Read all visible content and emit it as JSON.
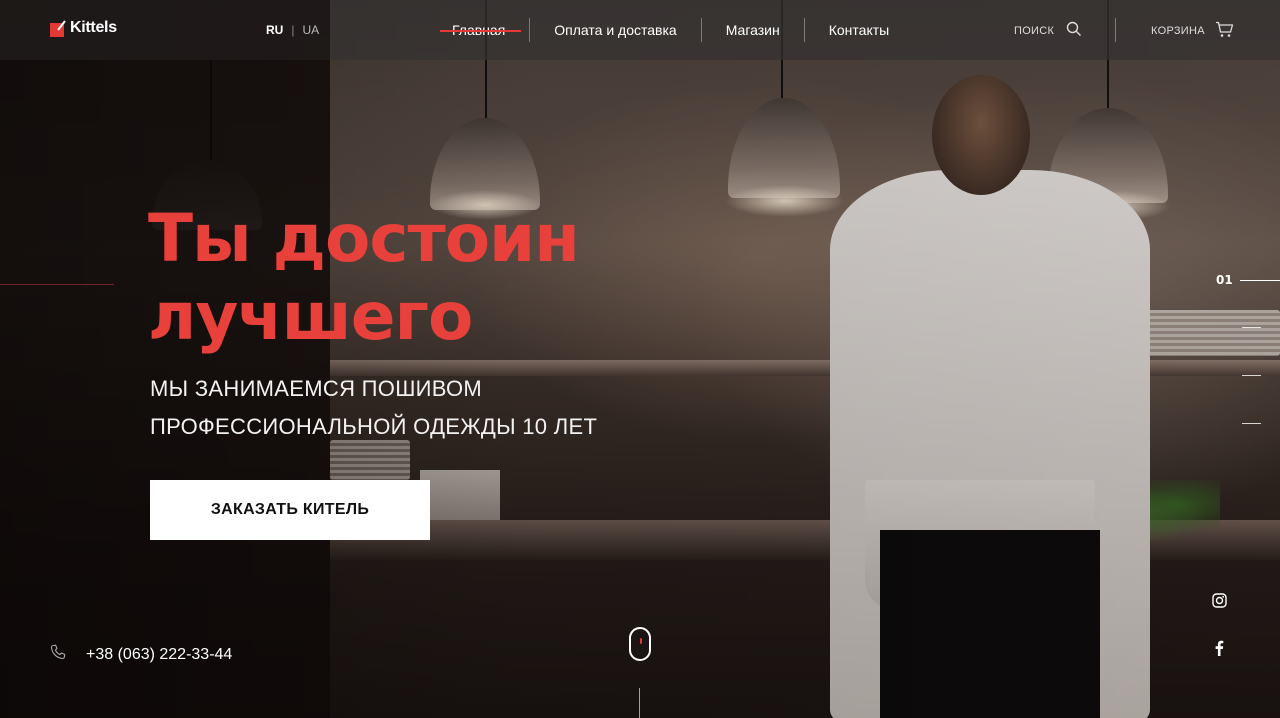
{
  "brand": {
    "name": "Kittels",
    "accent": "#e53935"
  },
  "languages": {
    "items": [
      "RU",
      "UA"
    ],
    "active": "RU"
  },
  "nav": {
    "items": [
      {
        "label": "Главная",
        "active": true
      },
      {
        "label": "Оплата и доставка",
        "active": false
      },
      {
        "label": "Магазин",
        "active": false
      },
      {
        "label": "Контакты",
        "active": false
      }
    ]
  },
  "header": {
    "search_label": "ПОИСК",
    "search_icon": "search-icon",
    "cart_label": "КОРЗИНА",
    "cart_icon": "cart-icon"
  },
  "hero": {
    "title_line1": "Ты достоин",
    "title_line2": "лучшего",
    "subtitle_line1": "МЫ ЗАНИМАЕМСЯ ПОШИВОМ",
    "subtitle_line2": "ПРОФЕССИОНАЛЬНОЙ ОДЕЖДЫ 10 ЛЕТ",
    "cta_label": "ЗАКАЗАТЬ КИТЕЛЬ"
  },
  "contact": {
    "phone": "+38 (063) 222-33-44",
    "phone_icon": "phone-icon"
  },
  "slider": {
    "current": "01",
    "total_slides": 4
  },
  "social": [
    "instagram-icon",
    "facebook-icon"
  ],
  "scroll_indicator": "mouse-scroll-icon"
}
